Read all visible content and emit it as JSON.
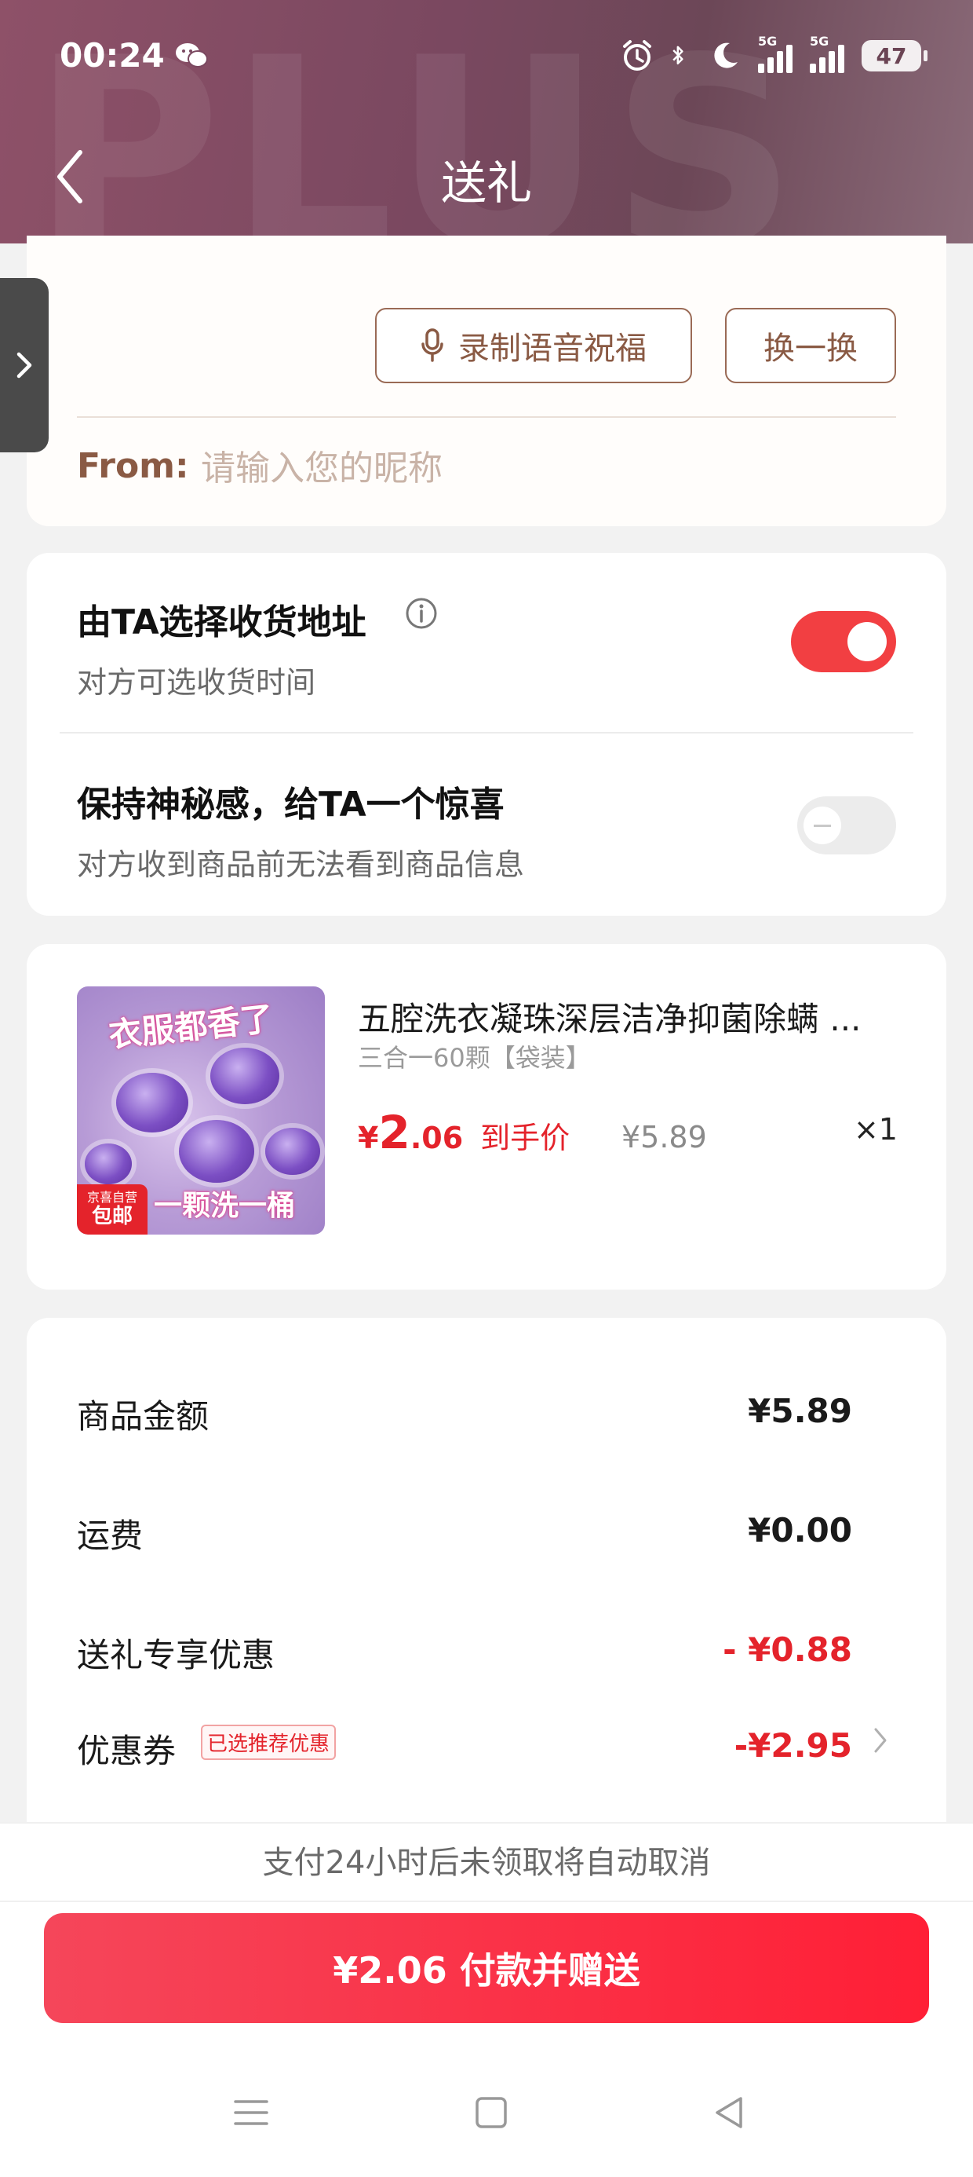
{
  "status_bar": {
    "time": "00:24",
    "network_1": "5G",
    "network_2": "5G",
    "battery": "47"
  },
  "nav": {
    "title": "送礼",
    "watermark": "PLUS"
  },
  "greeting_card": {
    "voice_button": "录制语音祝福",
    "swap_button": "换一换",
    "from_label": "From:",
    "from_placeholder": "请输入您的昵称",
    "from_value": ""
  },
  "options": {
    "address": {
      "title": "由TA选择收货地址",
      "subtitle": "对方可选收货时间",
      "enabled": true
    },
    "mystery": {
      "title": "保持神秘感，给TA一个惊喜",
      "subtitle": "对方收到商品前无法看到商品信息",
      "enabled": false
    }
  },
  "product": {
    "image_caption_top": "衣服都香了",
    "image_caption_bottom": "一颗洗一桶",
    "badge_line1": "京喜自营",
    "badge_line2": "包邮",
    "title": "五腔洗衣凝珠深层洁净抑菌除螨 ...",
    "spec": "三合一60颗【袋装】",
    "price_currency": "¥",
    "price_int": "2",
    "price_dec": ".06",
    "price_tag": "到手价",
    "original_price": "¥5.89",
    "quantity": "×1"
  },
  "summary": {
    "rows": [
      {
        "label": "商品金额",
        "value": "¥5.89"
      },
      {
        "label": "运费",
        "value": "¥0.00"
      },
      {
        "label": "送礼专享优惠",
        "value": "- ¥0.88"
      },
      {
        "label": "优惠券",
        "value": "-¥2.95"
      }
    ],
    "coupon_tag": "已选推荐优惠"
  },
  "footer": {
    "notice": "支付24小时后未领取将自动取消",
    "pay_button": "¥2.06 付款并赠送"
  },
  "colors": {
    "accent_red": "#e4232b",
    "brown": "#8a5a44",
    "header": "#7a4860"
  }
}
